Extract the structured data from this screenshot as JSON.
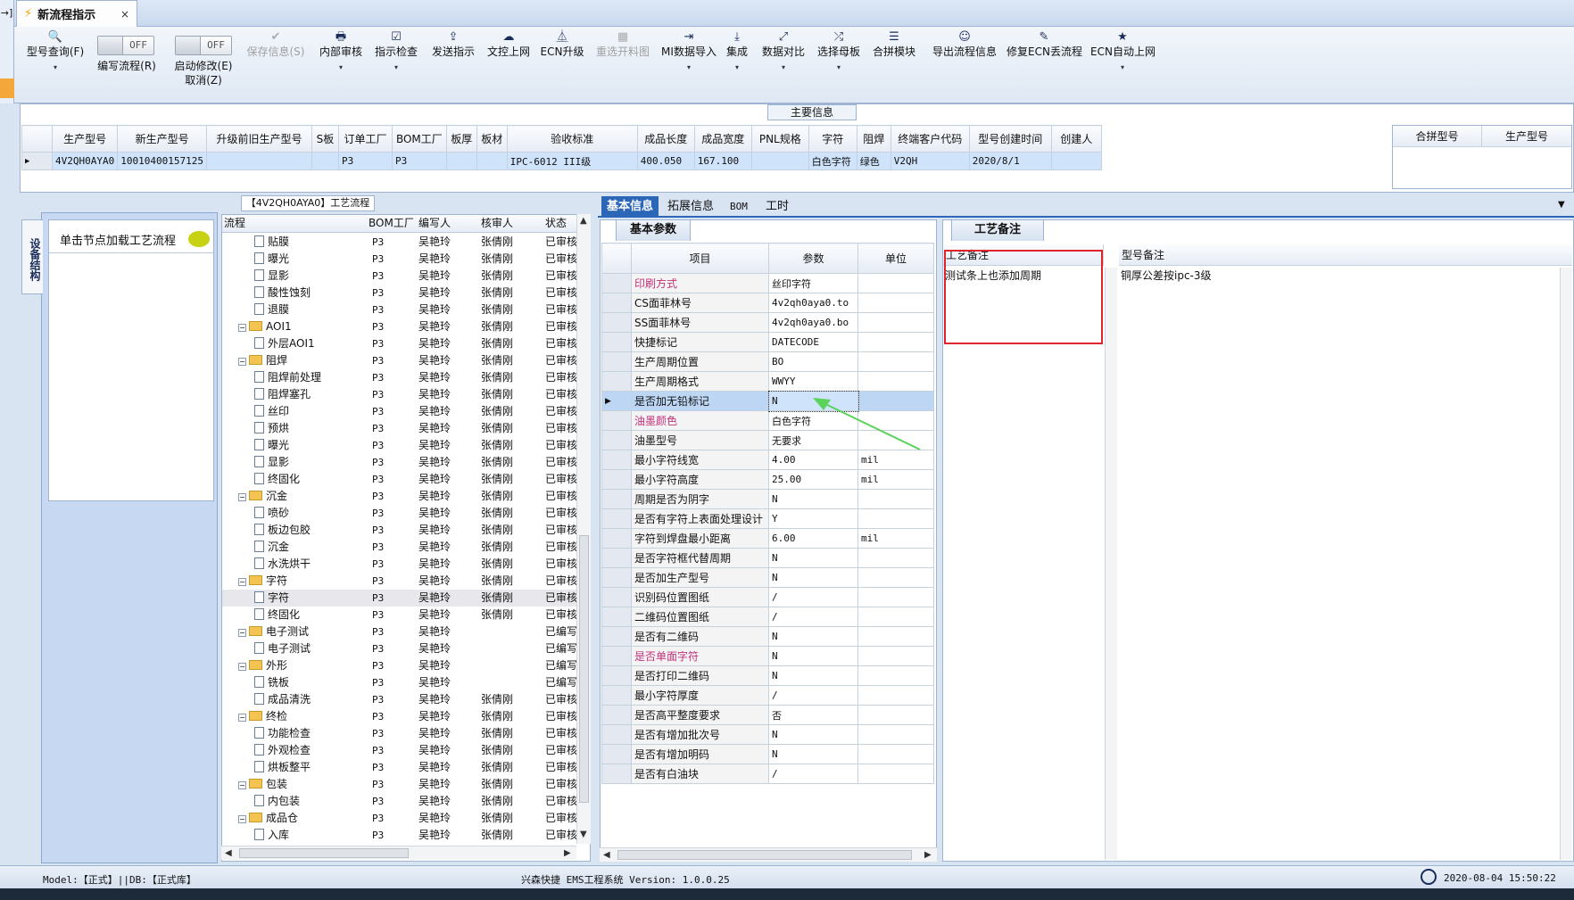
{
  "tab": {
    "title": "新流程指示",
    "close": "×",
    "stub": "→]"
  },
  "toolbar": {
    "items": [
      {
        "label": "型号查询(F)",
        "icon": "🔍"
      },
      {
        "label": "编写流程(R)"
      },
      {
        "label": "启动修改(E)",
        "sublabel": "取消(Z)"
      },
      {
        "label": "保存信息(S)",
        "icon": "✔"
      },
      {
        "label": "内部审核",
        "icon": "🖶"
      },
      {
        "label": "指示检查",
        "icon": "☑"
      },
      {
        "label": "发送指示",
        "icon": "⇪"
      },
      {
        "label": "文控上网",
        "icon": "☁"
      },
      {
        "label": "ECN升级",
        "icon": "⏅"
      },
      {
        "label": "重选开料图",
        "icon": "▦"
      },
      {
        "label": "MI数据导入",
        "icon": "⇥"
      },
      {
        "label": "集成",
        "icon": "⤓"
      },
      {
        "label": "数据对比",
        "icon": "⤢"
      },
      {
        "label": "选择母板",
        "icon": "⤮"
      },
      {
        "label": "合拼模块",
        "icon": "☰"
      },
      {
        "label": "导出流程信息",
        "icon": "☺"
      },
      {
        "label": "修复ECN丢流程",
        "icon": "✎"
      },
      {
        "label": "ECN自动上网",
        "icon": "★"
      }
    ],
    "off": "OFF",
    "dropdown": "▾"
  },
  "main_info": {
    "title": "主要信息",
    "headers": [
      "生产型号",
      "新生产型号",
      "升级前旧生产型号",
      "S板",
      "订单工厂",
      "BOM工厂",
      "板厚",
      "板材",
      "验收标准",
      "成品长度",
      "成品宽度",
      "PNL规格",
      "字符",
      "阻焊",
      "终端客户代码",
      "型号创建时间",
      "创建人"
    ],
    "row": [
      "4V2QH0AYA0",
      "10010400157125",
      "",
      "",
      "P3",
      "P3",
      "",
      "",
      "IPC-6012 III级",
      "400.050",
      "167.100",
      "",
      "白色字符",
      "绿色",
      "V2QH",
      "2020/8/1",
      ""
    ],
    "right_headers": [
      "合拼型号",
      "生产型号"
    ]
  },
  "left_panel": {
    "vtab": "设备结构",
    "load_text": "单击节点加载工艺流程"
  },
  "tree": {
    "title": "【4V2QH0AYA0】工艺流程",
    "headers": [
      "流程",
      "BOM工厂",
      "编写人",
      "核审人",
      "状态"
    ],
    "rows": [
      {
        "label": "贴膜",
        "level": 2,
        "type": "doc",
        "bom": "P3",
        "writer": "吴艳玲",
        "reviewer": "张倩刚",
        "status": "已审核"
      },
      {
        "label": "曝光",
        "level": 2,
        "type": "doc",
        "bom": "P3",
        "writer": "吴艳玲",
        "reviewer": "张倩刚",
        "status": "已审核"
      },
      {
        "label": "显影",
        "level": 2,
        "type": "doc",
        "bom": "P3",
        "writer": "吴艳玲",
        "reviewer": "张倩刚",
        "status": "已审核"
      },
      {
        "label": "酸性蚀刻",
        "level": 2,
        "type": "doc",
        "bom": "P3",
        "writer": "吴艳玲",
        "reviewer": "张倩刚",
        "status": "已审核"
      },
      {
        "label": "退膜",
        "level": 2,
        "type": "doc",
        "bom": "P3",
        "writer": "吴艳玲",
        "reviewer": "张倩刚",
        "status": "已审核"
      },
      {
        "label": "AOI1",
        "level": 1,
        "type": "folder",
        "bom": "P3",
        "writer": "吴艳玲",
        "reviewer": "张倩刚",
        "status": "已审核"
      },
      {
        "label": "外层AOI1",
        "level": 2,
        "type": "doc",
        "bom": "P3",
        "writer": "吴艳玲",
        "reviewer": "张倩刚",
        "status": "已审核"
      },
      {
        "label": "阻焊",
        "level": 1,
        "type": "folder",
        "bom": "P3",
        "writer": "吴艳玲",
        "reviewer": "张倩刚",
        "status": "已审核"
      },
      {
        "label": "阻焊前处理",
        "level": 2,
        "type": "doc",
        "bom": "P3",
        "writer": "吴艳玲",
        "reviewer": "张倩刚",
        "status": "已审核"
      },
      {
        "label": "阻焊塞孔",
        "level": 2,
        "type": "doc",
        "bom": "P3",
        "writer": "吴艳玲",
        "reviewer": "张倩刚",
        "status": "已审核"
      },
      {
        "label": "丝印",
        "level": 2,
        "type": "doc",
        "bom": "P3",
        "writer": "吴艳玲",
        "reviewer": "张倩刚",
        "status": "已审核"
      },
      {
        "label": "预烘",
        "level": 2,
        "type": "doc",
        "bom": "P3",
        "writer": "吴艳玲",
        "reviewer": "张倩刚",
        "status": "已审核"
      },
      {
        "label": "曝光",
        "level": 2,
        "type": "doc",
        "bom": "P3",
        "writer": "吴艳玲",
        "reviewer": "张倩刚",
        "status": "已审核"
      },
      {
        "label": "显影",
        "level": 2,
        "type": "doc",
        "bom": "P3",
        "writer": "吴艳玲",
        "reviewer": "张倩刚",
        "status": "已审核"
      },
      {
        "label": "终固化",
        "level": 2,
        "type": "doc",
        "bom": "P3",
        "writer": "吴艳玲",
        "reviewer": "张倩刚",
        "status": "已审核"
      },
      {
        "label": "沉金",
        "level": 1,
        "type": "folder",
        "bom": "P3",
        "writer": "吴艳玲",
        "reviewer": "张倩刚",
        "status": "已审核"
      },
      {
        "label": "喷砂",
        "level": 2,
        "type": "doc",
        "bom": "P3",
        "writer": "吴艳玲",
        "reviewer": "张倩刚",
        "status": "已审核"
      },
      {
        "label": "板边包胶",
        "level": 2,
        "type": "doc",
        "bom": "P3",
        "writer": "吴艳玲",
        "reviewer": "张倩刚",
        "status": "已审核"
      },
      {
        "label": "沉金",
        "level": 2,
        "type": "doc",
        "bom": "P3",
        "writer": "吴艳玲",
        "reviewer": "张倩刚",
        "status": "已审核"
      },
      {
        "label": "水洗烘干",
        "level": 2,
        "type": "doc",
        "bom": "P3",
        "writer": "吴艳玲",
        "reviewer": "张倩刚",
        "status": "已审核"
      },
      {
        "label": "字符",
        "level": 1,
        "type": "folder",
        "bom": "P3",
        "writer": "吴艳玲",
        "reviewer": "张倩刚",
        "status": "已审核"
      },
      {
        "label": "字符",
        "level": 2,
        "type": "doc",
        "bom": "P3",
        "writer": "吴艳玲",
        "reviewer": "张倩刚",
        "status": "已审核",
        "selected": true
      },
      {
        "label": "终固化",
        "level": 2,
        "type": "doc",
        "bom": "P3",
        "writer": "吴艳玲",
        "reviewer": "张倩刚",
        "status": "已审核"
      },
      {
        "label": "电子测试",
        "level": 1,
        "type": "folder",
        "bom": "P3",
        "writer": "吴艳玲",
        "reviewer": "",
        "status": "已编写"
      },
      {
        "label": "电子测试",
        "level": 2,
        "type": "doc",
        "bom": "P3",
        "writer": "吴艳玲",
        "reviewer": "",
        "status": "已编写"
      },
      {
        "label": "外形",
        "level": 1,
        "type": "folder",
        "bom": "P3",
        "writer": "吴艳玲",
        "reviewer": "",
        "status": "已编写"
      },
      {
        "label": "铣板",
        "level": 2,
        "type": "doc",
        "bom": "P3",
        "writer": "吴艳玲",
        "reviewer": "",
        "status": "已编写"
      },
      {
        "label": "成品清洗",
        "level": 2,
        "type": "doc",
        "bom": "P3",
        "writer": "吴艳玲",
        "reviewer": "张倩刚",
        "status": "已审核"
      },
      {
        "label": "终检",
        "level": 1,
        "type": "folder",
        "bom": "P3",
        "writer": "吴艳玲",
        "reviewer": "张倩刚",
        "status": "已审核"
      },
      {
        "label": "功能检查",
        "level": 2,
        "type": "doc",
        "bom": "P3",
        "writer": "吴艳玲",
        "reviewer": "张倩刚",
        "status": "已审核"
      },
      {
        "label": "外观检查",
        "level": 2,
        "type": "doc",
        "bom": "P3",
        "writer": "吴艳玲",
        "reviewer": "张倩刚",
        "status": "已审核"
      },
      {
        "label": "烘板整平",
        "level": 2,
        "type": "doc",
        "bom": "P3",
        "writer": "吴艳玲",
        "reviewer": "张倩刚",
        "status": "已审核"
      },
      {
        "label": "包装",
        "level": 1,
        "type": "folder",
        "bom": "P3",
        "writer": "吴艳玲",
        "reviewer": "张倩刚",
        "status": "已审核"
      },
      {
        "label": "内包装",
        "level": 2,
        "type": "doc",
        "bom": "P3",
        "writer": "吴艳玲",
        "reviewer": "张倩刚",
        "status": "已审核"
      },
      {
        "label": "成品仓",
        "level": 1,
        "type": "folder",
        "bom": "P3",
        "writer": "吴艳玲",
        "reviewer": "张倩刚",
        "status": "已审核"
      },
      {
        "label": "入库",
        "level": 2,
        "type": "doc",
        "bom": "P3",
        "writer": "吴艳玲",
        "reviewer": "张倩刚",
        "status": "已审核"
      }
    ]
  },
  "mid_tabs": [
    "基本信息",
    "拓展信息",
    "BOM",
    "工时"
  ],
  "basic_params": {
    "subtab": "基本参数",
    "headers": [
      "项目",
      "参数",
      "单位"
    ],
    "rows": [
      {
        "item": "印刷方式",
        "value": "丝印字符",
        "unit": "",
        "pink": true
      },
      {
        "item": "CS面菲林号",
        "value": "4v2qh0aya0.to",
        "unit": ""
      },
      {
        "item": "SS面菲林号",
        "value": "4v2qh0aya0.bo",
        "unit": ""
      },
      {
        "item": "快捷标记",
        "value": "DATECODE",
        "unit": ""
      },
      {
        "item": "生产周期位置",
        "value": "BO",
        "unit": ""
      },
      {
        "item": "生产周期格式",
        "value": "WWYY",
        "unit": ""
      },
      {
        "item": "是否加无铅标记",
        "value": "N",
        "unit": "",
        "selected": true
      },
      {
        "item": "油墨颜色",
        "value": "白色字符",
        "unit": "",
        "pink": true
      },
      {
        "item": "油墨型号",
        "value": "无要求",
        "unit": ""
      },
      {
        "item": "最小字符线宽",
        "value": "4.00",
        "unit": "mil"
      },
      {
        "item": "最小字符高度",
        "value": "25.00",
        "unit": "mil"
      },
      {
        "item": "周期是否为阴字",
        "value": "N",
        "unit": ""
      },
      {
        "item": "是否有字符上表面处理设计",
        "value": "Y",
        "unit": ""
      },
      {
        "item": "字符到焊盘最小距离",
        "value": "6.00",
        "unit": "mil"
      },
      {
        "item": "是否字符框代替周期",
        "value": "N",
        "unit": ""
      },
      {
        "item": "是否加生产型号",
        "value": "N",
        "unit": ""
      },
      {
        "item": "识别码位置图纸",
        "value": "/",
        "unit": ""
      },
      {
        "item": "二维码位置图纸",
        "value": "/",
        "unit": ""
      },
      {
        "item": "是否有二维码",
        "value": "N",
        "unit": ""
      },
      {
        "item": "是否单面字符",
        "value": "N",
        "unit": "",
        "pink": true
      },
      {
        "item": "是否打印二维码",
        "value": "N",
        "unit": ""
      },
      {
        "item": "最小字符厚度",
        "value": "/",
        "unit": ""
      },
      {
        "item": "是否高平整度要求",
        "value": "否",
        "unit": ""
      },
      {
        "item": "是否有增加批次号",
        "value": "N",
        "unit": ""
      },
      {
        "item": "是否有增加明码",
        "value": "N",
        "unit": ""
      },
      {
        "item": "是否有白油块",
        "value": "/",
        "unit": ""
      }
    ]
  },
  "remarks": {
    "tab": "工艺备注",
    "col1": "工艺备注",
    "col2": "型号备注",
    "text1": "测试条上也添加周期",
    "text2": "铜厚公差按ipc-3级"
  },
  "status": {
    "left": "Model:【正式】||DB:【正式库】",
    "center": "兴森快捷 EMS工程系统 Version: 1.0.0.25",
    "time": "2020-08-04 15:50:22"
  },
  "colors": {
    "accent": "#2b66b8",
    "selection": "#cfe3fb",
    "highlight_box": "#e0242b",
    "pink_label": "#c2317a"
  }
}
